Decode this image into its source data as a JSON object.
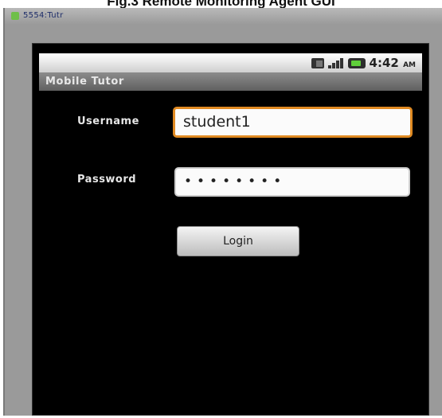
{
  "figure": {
    "caption": "Fig.3 Remote Monitoring Agent GUI"
  },
  "emulator": {
    "title": "5554:Tutr"
  },
  "status_bar": {
    "time": "4:42",
    "ampm": "AM",
    "icons": [
      "sd-card-icon",
      "signal-icon",
      "battery-icon"
    ]
  },
  "app": {
    "title": "Mobile Tutor"
  },
  "form": {
    "username_label": "Username",
    "username_value": "student1",
    "password_label": "Password",
    "password_value": "••••••••",
    "login_label": "Login"
  },
  "colors": {
    "focus_accent": "#e08a22",
    "screen_bg": "#000000",
    "emulator_frame": "#9a9a9a"
  }
}
